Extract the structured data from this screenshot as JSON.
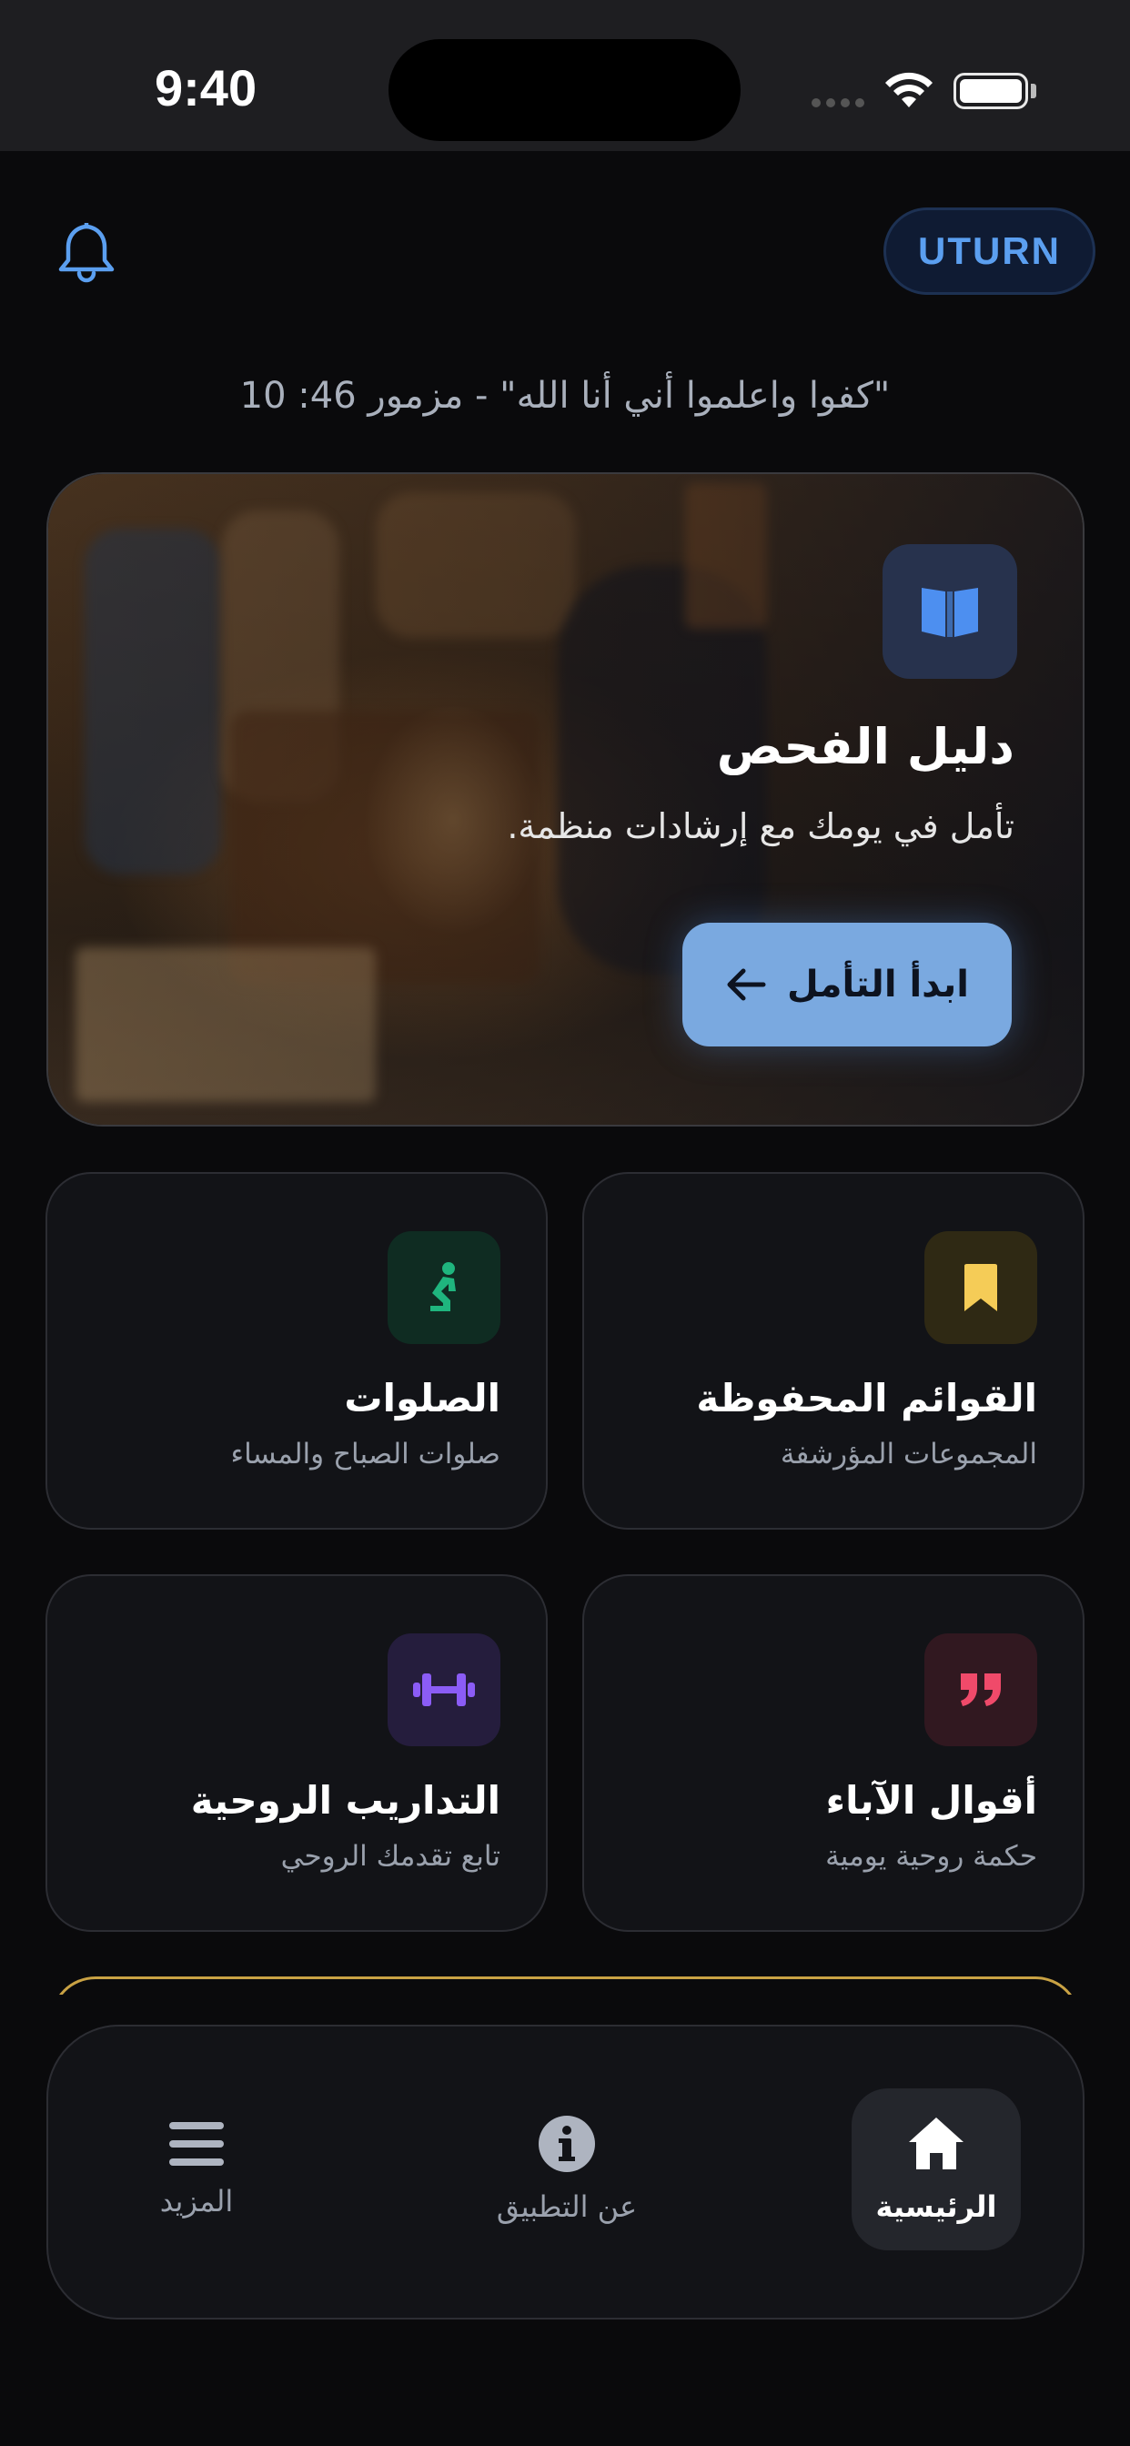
{
  "status_bar": {
    "time": "9:40"
  },
  "header": {
    "brand": "UTURN"
  },
  "verse": "\"كفوا واعلموا أني أنا الله\" - مزمور 46: 10",
  "hero": {
    "title": "دليل الفحص",
    "subtitle": "تأمل في يومك مع إرشادات منظمة.",
    "button_label": "ابدأ التأمل",
    "icon": "open-book-icon"
  },
  "tiles": [
    {
      "title": "القوائم المحفوظة",
      "subtitle": "المجموعات المؤرشفة",
      "icon": "bookmark-icon",
      "color": "#f5cc57"
    },
    {
      "title": "الصلوات",
      "subtitle": "صلوات الصباح والمساء",
      "icon": "praying-icon",
      "color": "#1fb57e"
    },
    {
      "title": "أقوال الآباء",
      "subtitle": "حكمة روحية يومية",
      "icon": "quote-icon",
      "color": "#f04a6a"
    },
    {
      "title": "التداريب الروحية",
      "subtitle": "تابع تقدمك الروحي",
      "icon": "dumbbell-icon",
      "color": "#8b5cf6"
    }
  ],
  "bottom_nav": [
    {
      "label": "الرئيسية",
      "icon": "home-icon",
      "active": true
    },
    {
      "label": "عن التطبيق",
      "icon": "info-icon",
      "active": false
    },
    {
      "label": "المزيد",
      "icon": "menu-icon",
      "active": false
    }
  ],
  "colors": {
    "accent": "#5b9ff0",
    "background": "#0a0a0c",
    "card": "#121317",
    "hero_button": "#7aa9e0"
  }
}
